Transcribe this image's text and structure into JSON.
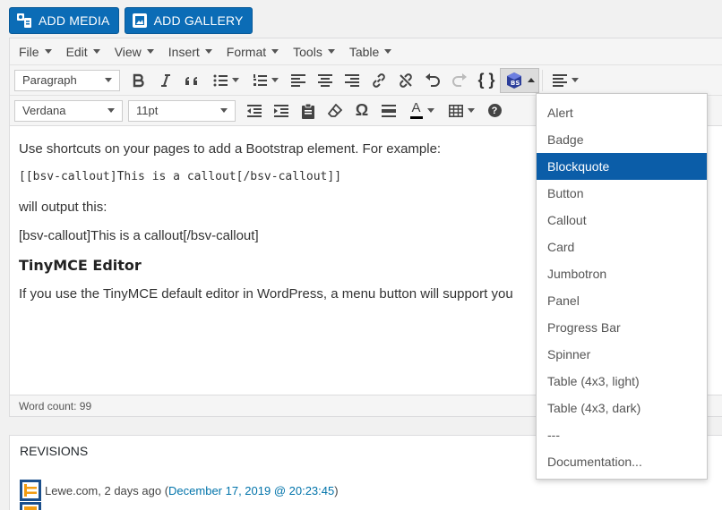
{
  "media": {
    "add_media": "ADD MEDIA",
    "add_gallery": "ADD GALLERY"
  },
  "menubar": {
    "items": [
      "File",
      "Edit",
      "View",
      "Insert",
      "Format",
      "Tools",
      "Table"
    ]
  },
  "toolbar": {
    "format_select": "Paragraph",
    "font_family": "Verdana",
    "font_size": "11pt",
    "code_label": "{ }",
    "omega_label": "Ω",
    "text_color_label": "A",
    "help_label": "?"
  },
  "content": {
    "line1": "Use shortcuts on your pages to add a Bootstrap element. For example:",
    "code": "[[bsv-callout]This is a callout[/bsv-callout]]",
    "line2": "will output this:",
    "line3": "[bsv-callout]This is a callout[/bsv-callout]",
    "heading": "TinyMCE Editor",
    "line4": "If you use the TinyMCE default editor in WordPress, a menu button will support you"
  },
  "status": {
    "word_count": "Word count: 99"
  },
  "revisions": {
    "title": "REVISIONS",
    "entry_author": "Lewe.com, 2 days ago (",
    "entry_link": "December 17, 2019 @ 20:23:45",
    "entry_close": ")"
  },
  "dropdown": {
    "items": [
      "Alert",
      "Badge",
      "Blockquote",
      "Button",
      "Callout",
      "Card",
      "Jumbotron",
      "Panel",
      "Progress Bar",
      "Spinner",
      "Table (4x3, light)",
      "Table (4x3, dark)",
      "---",
      "Documentation..."
    ],
    "selected": "Blockquote"
  },
  "colors": {
    "accent": "#0b6cb6",
    "selected": "#0b5da8",
    "link": "#0073aa"
  }
}
